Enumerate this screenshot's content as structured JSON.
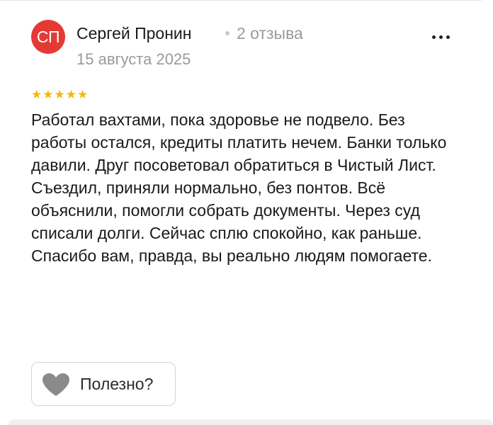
{
  "review": {
    "avatar": {
      "initials": "СП",
      "color": "#e53935"
    },
    "author": "Сергей Пронин",
    "reviews_count": "2 отзыва",
    "date": "15 августа 2025",
    "rating": 5,
    "stars_text": "★★★★★",
    "star_color": "#f5b70a",
    "text": "Работал вахтами, пока здоровье не подвело. Без работы остался, кредиты платить нечем. Банки только давили. Друг посоветовал обратиться в Чистый Лист. Съездил, приняли нормально, без понтов. Всё объяснили, помогли собрать документы. Через суд списали долги. Сейчас сплю спокойно, как раньше. Спасибо вам, правда, вы реально людям помогаете.",
    "helpful_label": "Полезно?",
    "icons": {
      "menu": "more-horizontal-icon",
      "like": "heart-icon"
    }
  }
}
